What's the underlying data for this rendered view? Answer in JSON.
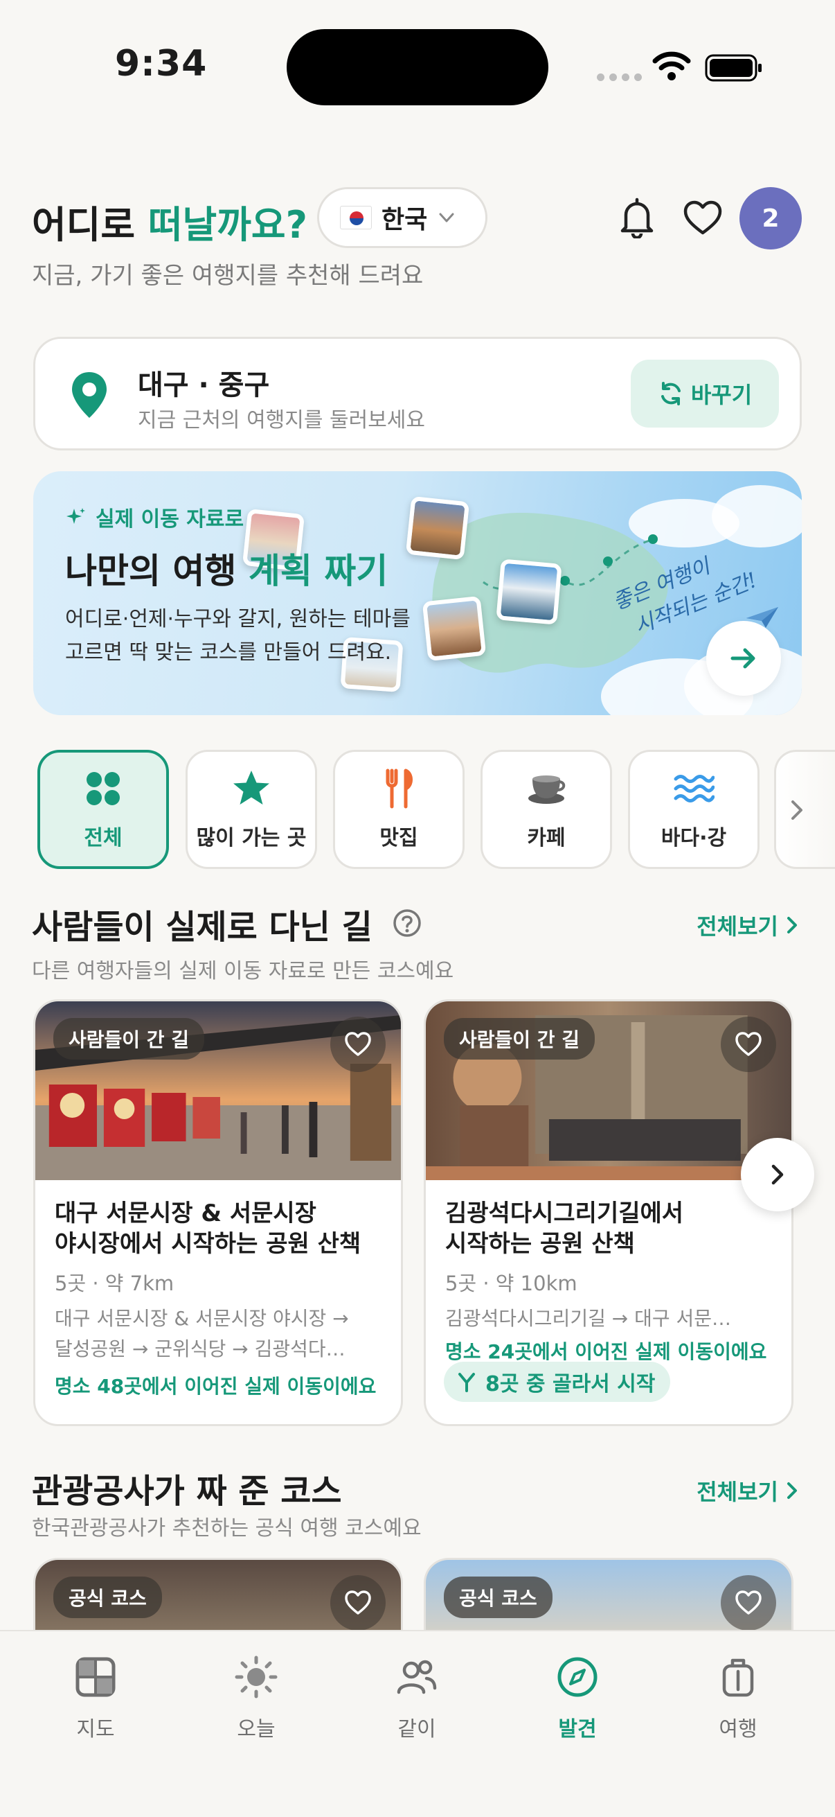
{
  "status_bar": {
    "time": "9:34"
  },
  "header": {
    "greeting_prefix": "어디로",
    "greeting_accent": "떠날까요?",
    "subtitle": "지금, 가기 좋은 여행지를 추천해 드려요",
    "country": "한국",
    "notification_count": "2",
    "accent_color": "#169879"
  },
  "location": {
    "title": "대구 · 중구",
    "subtitle": "지금 근처의 여행지를 둘러보세요",
    "change_label": "바꾸기"
  },
  "banner": {
    "kicker": "실제 이동 자료로",
    "title_prefix": "나만의 여행",
    "title_accent": "계획 짜기",
    "desc_line1": "어디로·언제·누구와 갈지, 원하는 테마를",
    "desc_line2": "고르면 딱 맞는 코스를 만들어 드려요.",
    "script_line1": "좋은 여행이",
    "script_line2": "시작되는 순간!"
  },
  "categories": [
    {
      "label": "전체",
      "icon": "grid-icon"
    },
    {
      "label": "많이 가는 곳",
      "icon": "star-icon"
    },
    {
      "label": "맛집",
      "icon": "utensils-icon"
    },
    {
      "label": "카페",
      "icon": "coffee-cup-icon"
    },
    {
      "label": "바다·강",
      "icon": "waves-icon"
    }
  ],
  "section_routes": {
    "title": "사람들이 실제로 다닌 길",
    "subtitle": "다른 여행자들의 실제 이동 자료로 만든 코스예요",
    "see_all": "전체보기",
    "cards": [
      {
        "tag": "사람들이 간 길",
        "title_line1": "대구 서문시장 & 서문시장",
        "title_line2": "야시장에서 시작하는 공원 산책",
        "meta": "5곳 · 약 7km",
        "route_line1": "대구 서문시장 & 서문시장 야시장 →",
        "route_line2": "달성공원 → 군위식당 → 김광석다…",
        "note": "명소 48곳에서 이어진 실제 이동이에요"
      },
      {
        "tag": "사람들이 간 길",
        "title_line1": "김광석다시그리기길에서",
        "title_line2": "시작하는 공원 산책",
        "meta": "5곳 · 약 10km",
        "route_line1": "김광석다시그리기길 → 대구 서문…",
        "note": "명소 24곳에서 이어진 실제 이동이에요",
        "chip": "8곳 중 골라서 시작"
      }
    ]
  },
  "section_official": {
    "title": "관광공사가 짜 준 코스",
    "subtitle": "한국관광공사가 추천하는 공식 여행 코스예요",
    "see_all": "전체보기",
    "cards": [
      {
        "tag": "공식 코스"
      },
      {
        "tag": "공식 코스"
      }
    ]
  },
  "tabbar": [
    {
      "label": "지도",
      "icon": "map-grid-icon"
    },
    {
      "label": "오늘",
      "icon": "sun-icon"
    },
    {
      "label": "같이",
      "icon": "people-icon"
    },
    {
      "label": "발견",
      "icon": "compass-icon",
      "active": true
    },
    {
      "label": "여행",
      "icon": "luggage-icon"
    }
  ]
}
